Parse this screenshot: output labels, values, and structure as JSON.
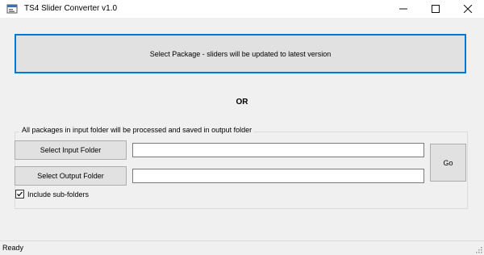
{
  "window": {
    "title": "TS4 Slider Converter v1.0",
    "icons": {
      "app": "app-icon",
      "minimize": "minimize-icon",
      "maximize": "maximize-icon",
      "close": "close-icon"
    }
  },
  "main": {
    "select_package_label": "Select Package - sliders will be updated to latest version",
    "or_label": "OR",
    "folder_group": {
      "legend": "All packages in input folder will be processed and saved in output folder",
      "select_input_label": "Select Input Folder",
      "input_value": "",
      "select_output_label": "Select Output Folder",
      "output_value": "",
      "go_label": "Go",
      "include_subfolders": {
        "label": "Include sub-folders",
        "checked": true
      }
    }
  },
  "status": {
    "text": "Ready"
  },
  "colors": {
    "focus_border": "#0078d7",
    "button_bg": "#e1e1e1",
    "window_bg": "#f0f0f0"
  }
}
